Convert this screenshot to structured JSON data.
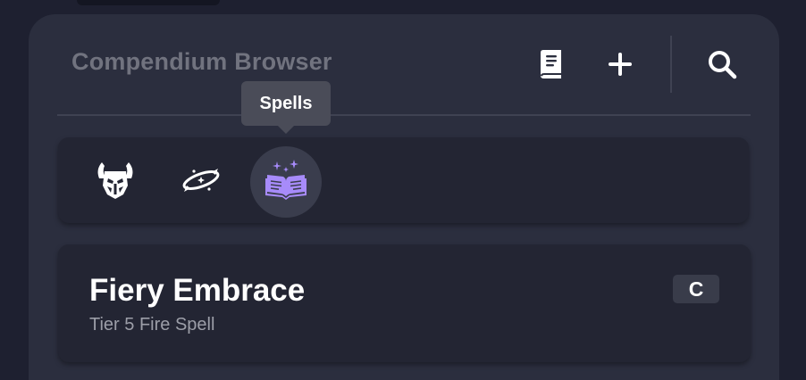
{
  "browser": {
    "title": "Compendium Browser",
    "toolbar": {
      "book_icon": "book-icon",
      "add_icon": "plus-icon",
      "search_icon": "search-icon"
    }
  },
  "filters": {
    "items": [
      {
        "id": "adversaries",
        "icon": "horned-helmet-icon",
        "active": false
      },
      {
        "id": "environments",
        "icon": "orbit-ring-icon",
        "active": false
      },
      {
        "id": "spells",
        "icon": "spellbook-icon",
        "active": true
      }
    ],
    "tooltip": "Spells"
  },
  "result": {
    "name": "Fiery Embrace",
    "subtitle": "Tier 5 Fire Spell",
    "badge": "C"
  },
  "colors": {
    "background": "#1e2030",
    "panel": "#2b2e3e",
    "card": "#232533",
    "title_muted": "#71737f",
    "spell_accent": "#a78bfa"
  }
}
